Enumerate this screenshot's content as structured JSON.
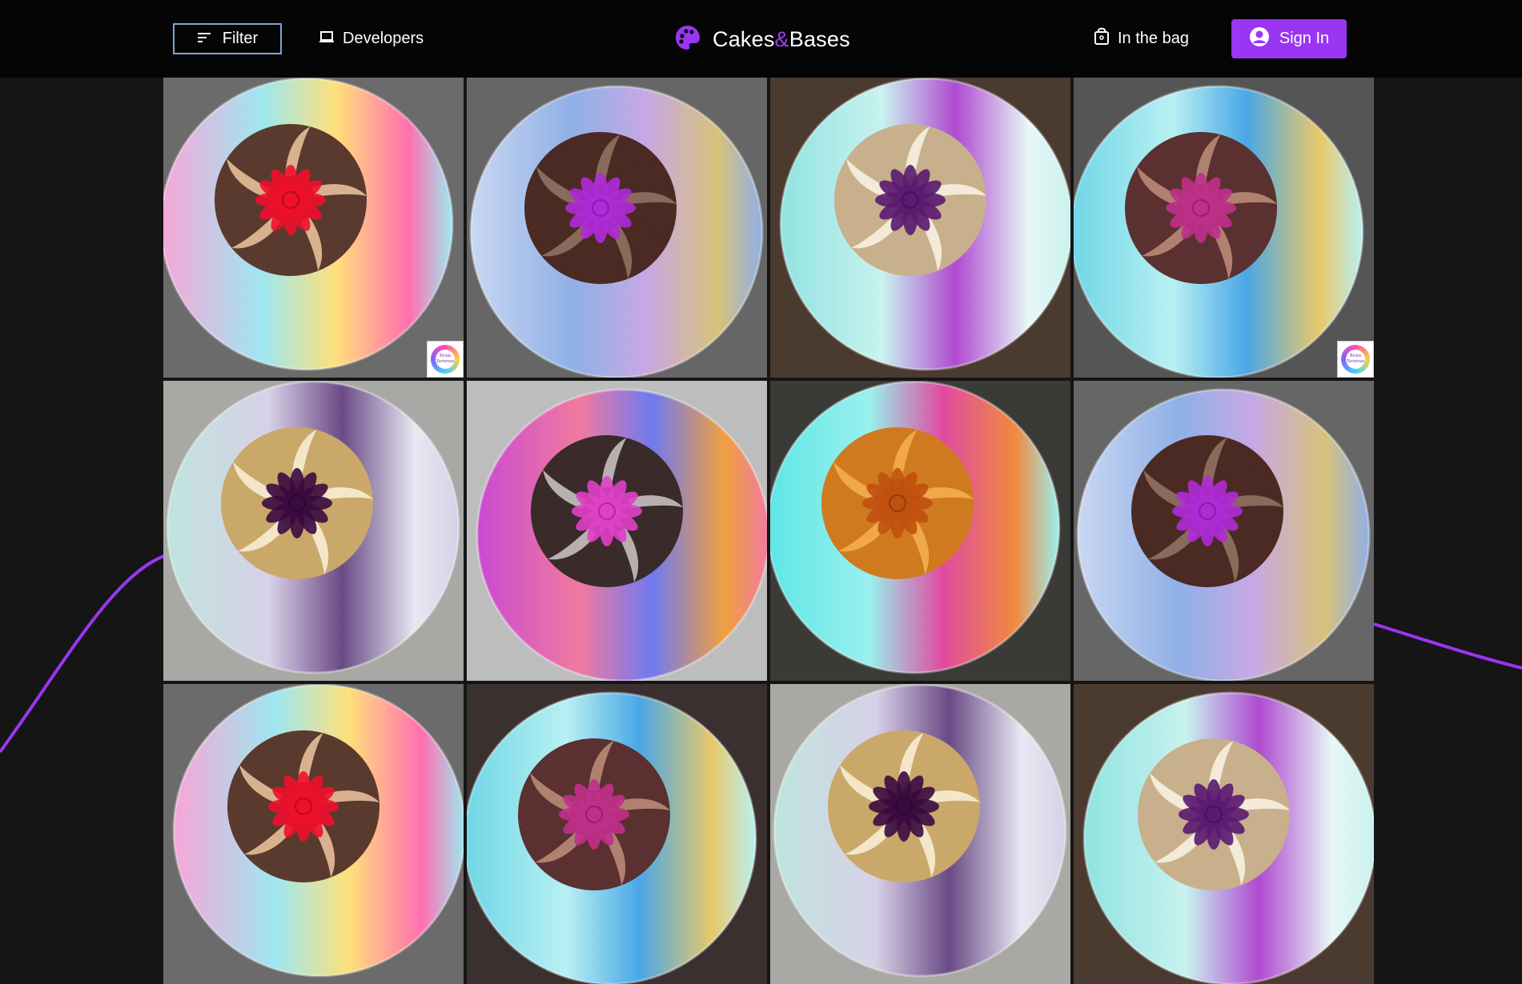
{
  "header": {
    "filter_label": "Filter",
    "developers_label": "Developers",
    "logo": {
      "part1": "Cakes",
      "amp": "&",
      "part2": "Bases",
      "icon": "palette-icon"
    },
    "bag_label": "In the bag",
    "signin_label": "Sign In"
  },
  "colors": {
    "accent": "#9a35f2",
    "header_bg": "#050505",
    "page_bg": "#151515",
    "filter_border": "#7ea4d6"
  },
  "gallery": {
    "badge_text": "Tortas Tortereas",
    "tiles": [
      {
        "alt": "Chocolate bundt cake with red flower on pastel rainbow board",
        "bg": "#6b6b6b",
        "plate": [
          "#f7a6d8",
          "#9ee7f0",
          "#ffe07a",
          "#ff6fb0"
        ],
        "cake": [
          "#5a3a2e",
          "#d8b28f"
        ],
        "flower": "#f0102c",
        "badge": true
      },
      {
        "alt": "Chocolate bundt cake with purple flower on blue and gold board",
        "bg": "#666666",
        "plate": [
          "#c9d7f2",
          "#8fb0e6",
          "#c7a8e6",
          "#d8c27a"
        ],
        "cake": [
          "#4a2a22",
          "#8a6a5a"
        ],
        "flower": "#b02ad8",
        "badge": false
      },
      {
        "alt": "Vanilla bundt cake with purple flower on aqua board",
        "bg": "#4a3a30",
        "plate": [
          "#8fe3e0",
          "#c9f2ef",
          "#b04ad0",
          "#e7f7f6"
        ],
        "cake": [
          "#c8b08c",
          "#f3ead8"
        ],
        "flower": "#5a1a70",
        "badge": false
      },
      {
        "alt": "Chocolate bundt cake with pink flower on turquoise board",
        "bg": "#555555",
        "plate": [
          "#6fd6e6",
          "#b8f0f2",
          "#4aa7e6",
          "#e8c86a"
        ],
        "cake": [
          "#5a3030",
          "#b08070"
        ],
        "flower": "#c0308a",
        "badge": true
      },
      {
        "alt": "Gold bundt cake with dark purple flower on lavender board",
        "bg": "#a8a8a4",
        "plate": [
          "#bfe4de",
          "#d8d0e6",
          "#6a4a86",
          "#e8e8f2"
        ],
        "cake": [
          "#c9a86a",
          "#f4e6c8"
        ],
        "flower": "#3a0a40",
        "badge": false
      },
      {
        "alt": "Chocolate bundt cake with magenta flower on multicolor board",
        "bg": "#bdbdbd",
        "plate": [
          "#c84ad0",
          "#f07aa0",
          "#6f7af0",
          "#f0a040"
        ],
        "cake": [
          "#3a2a2a",
          "#b8b0b0"
        ],
        "flower": "#e040c8",
        "badge": false
      },
      {
        "alt": "Orange bundt cake on turquoise board with pink streaks",
        "bg": "#3a3a36",
        "plate": [
          "#5fe6e6",
          "#9af0ee",
          "#e04aa0",
          "#f08a40"
        ],
        "cake": [
          "#d07a20",
          "#f0a848"
        ],
        "flower": "#c05010",
        "badge": false
      },
      {
        "alt": "Chocolate bundt cake with purple flower on blue and gold board",
        "bg": "#666666",
        "plate": [
          "#c9d7f2",
          "#8fb0e6",
          "#c7a8e6",
          "#d8c27a"
        ],
        "cake": [
          "#4a2a22",
          "#8a6a5a"
        ],
        "flower": "#b02ad8",
        "badge": false
      },
      {
        "alt": "Chocolate bundt cake with red flower on pastel rainbow board",
        "bg": "#6b6b6b",
        "plate": [
          "#f7a6d8",
          "#9ee7f0",
          "#ffe07a",
          "#ff6fb0"
        ],
        "cake": [
          "#5a3a2e",
          "#d8b28f"
        ],
        "flower": "#f0102c",
        "badge": false
      },
      {
        "alt": "Chocolate bundt cake with pink flower on turquoise board",
        "bg": "#3a3030",
        "plate": [
          "#6fd6e6",
          "#b8f0f2",
          "#4aa7e6",
          "#e8c86a"
        ],
        "cake": [
          "#5a3030",
          "#b08070"
        ],
        "flower": "#c0308a",
        "badge": false
      },
      {
        "alt": "Gold bundt cake with dark purple flower on lavender board",
        "bg": "#a8a8a4",
        "plate": [
          "#bfe4de",
          "#d8d0e6",
          "#6a4a86",
          "#e8e8f2"
        ],
        "cake": [
          "#c9a86a",
          "#f4e6c8"
        ],
        "flower": "#3a0a40",
        "badge": false
      },
      {
        "alt": "Vanilla bundt cake with purple flower on aqua board",
        "bg": "#4a3a30",
        "plate": [
          "#8fe3e0",
          "#c9f2ef",
          "#b04ad0",
          "#e7f7f6"
        ],
        "cake": [
          "#c8b08c",
          "#f3ead8"
        ],
        "flower": "#5a1a70",
        "badge": false
      }
    ]
  }
}
